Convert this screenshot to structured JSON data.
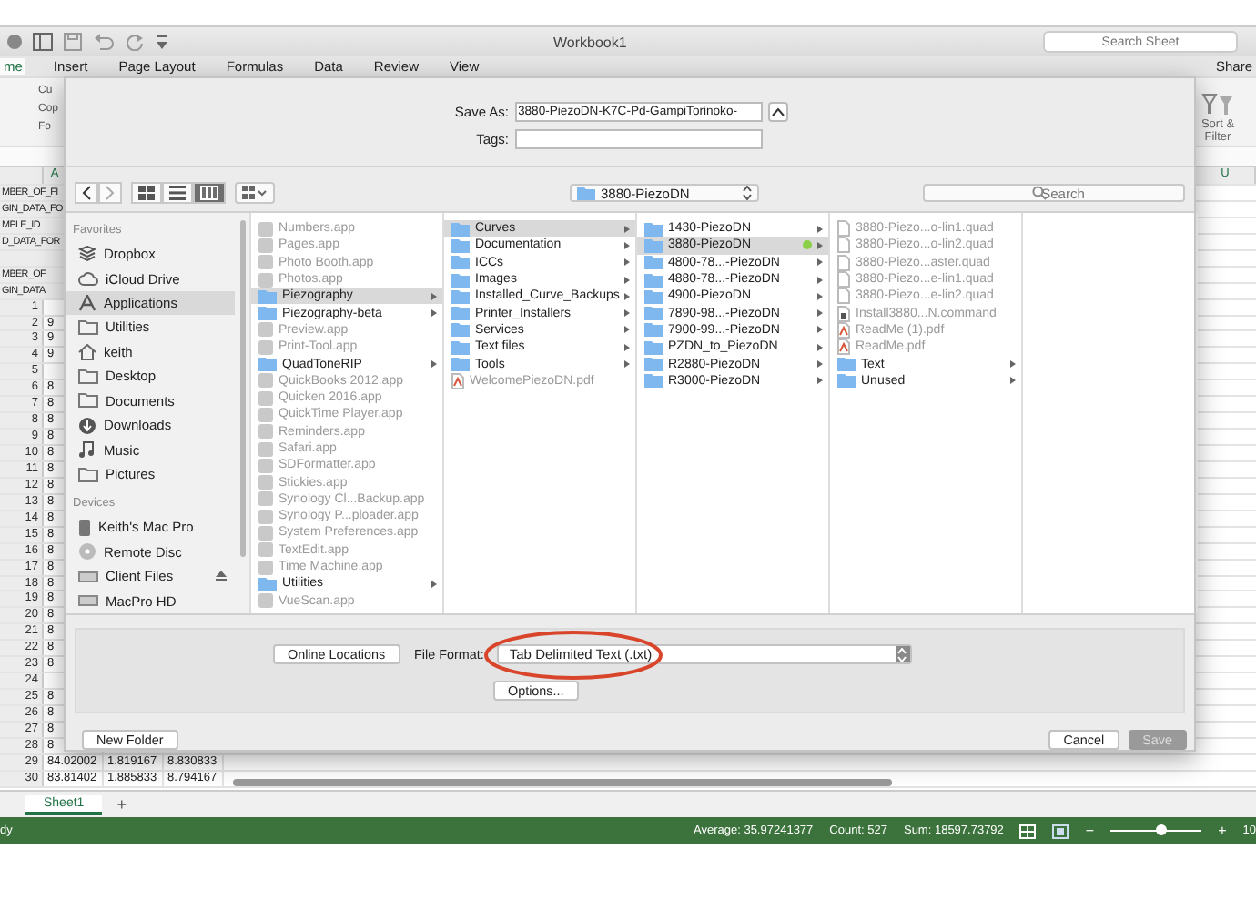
{
  "window": {
    "title": "Workbook1",
    "search_placeholder": "Search Sheet"
  },
  "ribbon_tabs": [
    {
      "label": "me",
      "selected": true
    },
    {
      "label": "Insert",
      "selected": false
    },
    {
      "label": "Page Layout",
      "selected": false
    },
    {
      "label": "Formulas",
      "selected": false
    },
    {
      "label": "Data",
      "selected": false
    },
    {
      "label": "Review",
      "selected": false
    },
    {
      "label": "View",
      "selected": false
    }
  ],
  "share": "Share",
  "ribbon": {
    "clipboard": [
      "Cu",
      "Cop",
      "Fo"
    ],
    "sort_filter": "Sort & Filter"
  },
  "grid": {
    "column_headers": [
      "A",
      "U"
    ],
    "label_rows": [
      "MBER_OF_FI",
      "GIN_DATA_FO",
      "MPLE_ID",
      "D_DATA_FOR",
      "",
      "MBER_OF",
      "GIN_DATA"
    ],
    "rows": [
      {
        "number": "1",
        "cells": []
      },
      {
        "number": "2",
        "cells": [
          "9"
        ]
      },
      {
        "number": "3",
        "cells": [
          "9"
        ]
      },
      {
        "number": "4",
        "cells": [
          "9"
        ]
      },
      {
        "number": "5",
        "cells": []
      },
      {
        "number": "6",
        "cells": [
          "8"
        ]
      },
      {
        "number": "7",
        "cells": [
          "8"
        ]
      },
      {
        "number": "8",
        "cells": [
          "8"
        ]
      },
      {
        "number": "9",
        "cells": [
          "8"
        ]
      },
      {
        "number": "10",
        "cells": [
          "8"
        ]
      },
      {
        "number": "11",
        "cells": [
          "8"
        ]
      },
      {
        "number": "12",
        "cells": [
          "8"
        ]
      },
      {
        "number": "13",
        "cells": [
          "8"
        ]
      },
      {
        "number": "14",
        "cells": [
          "8"
        ]
      },
      {
        "number": "15",
        "cells": [
          "8"
        ]
      },
      {
        "number": "16",
        "cells": [
          "8"
        ]
      },
      {
        "number": "17",
        "cells": [
          "8"
        ]
      },
      {
        "number": "18",
        "cells": [
          "8"
        ]
      },
      {
        "number": "19",
        "cells": [
          "8"
        ]
      },
      {
        "number": "20",
        "cells": [
          "8"
        ]
      },
      {
        "number": "21",
        "cells": [
          "8"
        ]
      },
      {
        "number": "22",
        "cells": [
          "8"
        ]
      },
      {
        "number": "23",
        "cells": [
          "8"
        ]
      },
      {
        "number": "24",
        "cells": []
      },
      {
        "number": "25",
        "cells": [
          "8"
        ]
      },
      {
        "number": "26",
        "cells": [
          "8"
        ]
      },
      {
        "number": "27",
        "cells": [
          "8"
        ]
      },
      {
        "number": "28",
        "cells": [
          "8"
        ]
      },
      {
        "number": "29",
        "cells": [
          "84.02002",
          "1.819167",
          "8.830833"
        ]
      },
      {
        "number": "30",
        "cells": [
          "83.81402",
          "1.885833",
          "8.794167"
        ]
      }
    ]
  },
  "sheet_tabs": [
    {
      "label": "Sheet1",
      "selected": true
    }
  ],
  "add_sheet": "+",
  "status_bar": {
    "mode": "dy",
    "average": "Average: 35.97241377",
    "count": "Count: 527",
    "sum": "Sum: 18597.73792",
    "zoom_out": "−",
    "zoom_in": "+",
    "zoom_value": "10",
    "zoom": {
      "level": 0.55
    }
  },
  "dialog": {
    "save_as_label": "Save As:",
    "save_as_value": "3880-PiezoDN-K7C-Pd-GampiTorinoko-",
    "tags_label": "Tags:",
    "view_modes": [
      {
        "kind": "icons",
        "selected": false
      },
      {
        "kind": "list",
        "selected": false
      },
      {
        "kind": "columns",
        "selected": true
      }
    ],
    "location": "3880-PiezoDN",
    "search_placeholder": "Search",
    "sidebar": [
      {
        "heading": "Favorites",
        "items": [
          {
            "label": "Dropbox",
            "kind": "box",
            "selected": false,
            "ejectable": false
          },
          {
            "label": "iCloud Drive",
            "kind": "cloud",
            "selected": false,
            "ejectable": false
          },
          {
            "label": "Applications",
            "kind": "apps",
            "selected": true,
            "ejectable": false
          },
          {
            "label": "Utilities",
            "kind": "folder",
            "selected": false,
            "ejectable": false
          },
          {
            "label": "keith",
            "kind": "home",
            "selected": false,
            "ejectable": false
          },
          {
            "label": "Desktop",
            "kind": "folder",
            "selected": false,
            "ejectable": false
          },
          {
            "label": "Documents",
            "kind": "folder",
            "selected": false,
            "ejectable": false
          },
          {
            "label": "Downloads",
            "kind": "download",
            "selected": false,
            "ejectable": false
          },
          {
            "label": "Music",
            "kind": "music",
            "selected": false,
            "ejectable": false
          },
          {
            "label": "Pictures",
            "kind": "folder",
            "selected": false,
            "ejectable": false
          }
        ]
      },
      {
        "heading": "Devices",
        "items": [
          {
            "label": "Keith's Mac Pro",
            "kind": "computer",
            "selected": false,
            "ejectable": false
          },
          {
            "label": "Remote Disc",
            "kind": "disc",
            "selected": false,
            "ejectable": false
          },
          {
            "label": "Client Files",
            "kind": "drive",
            "selected": false,
            "ejectable": true
          },
          {
            "label": "MacPro HD",
            "kind": "drive",
            "selected": false,
            "ejectable": false
          }
        ]
      }
    ],
    "columns": [
      [
        {
          "name": "Numbers.app",
          "kind": "app",
          "selected": false
        },
        {
          "name": "Pages.app",
          "kind": "app",
          "selected": false
        },
        {
          "name": "Photo Booth.app",
          "kind": "app",
          "selected": false
        },
        {
          "name": "Photos.app",
          "kind": "app",
          "selected": false
        },
        {
          "name": "Piezography",
          "kind": "folder",
          "selected": true
        },
        {
          "name": "Piezography-beta",
          "kind": "folder",
          "selected": false
        },
        {
          "name": "Preview.app",
          "kind": "app",
          "selected": false
        },
        {
          "name": "Print-Tool.app",
          "kind": "app",
          "selected": false
        },
        {
          "name": "QuadToneRIP",
          "kind": "folder",
          "selected": false
        },
        {
          "name": "QuickBooks 2012.app",
          "kind": "app",
          "selected": false
        },
        {
          "name": "Quicken 2016.app",
          "kind": "app",
          "selected": false
        },
        {
          "name": "QuickTime Player.app",
          "kind": "app",
          "selected": false
        },
        {
          "name": "Reminders.app",
          "kind": "app",
          "selected": false
        },
        {
          "name": "Safari.app",
          "kind": "app",
          "selected": false
        },
        {
          "name": "SDFormatter.app",
          "kind": "app",
          "selected": false
        },
        {
          "name": "Stickies.app",
          "kind": "app",
          "selected": false
        },
        {
          "name": "Synology Cl...Backup.app",
          "kind": "app",
          "selected": false
        },
        {
          "name": "Synology P...ploader.app",
          "kind": "app",
          "selected": false
        },
        {
          "name": "System Preferences.app",
          "kind": "app",
          "selected": false
        },
        {
          "name": "TextEdit.app",
          "kind": "app",
          "selected": false
        },
        {
          "name": "Time Machine.app",
          "kind": "app",
          "selected": false
        },
        {
          "name": "Utilities",
          "kind": "folder",
          "selected": false
        },
        {
          "name": "VueScan.app",
          "kind": "app",
          "selected": false
        }
      ],
      [
        {
          "name": "Curves",
          "kind": "folder",
          "selected": true
        },
        {
          "name": "Documentation",
          "kind": "folder",
          "selected": false
        },
        {
          "name": "ICCs",
          "kind": "folder",
          "selected": false
        },
        {
          "name": "Images",
          "kind": "folder",
          "selected": false
        },
        {
          "name": "Installed_Curve_Backups",
          "kind": "folder",
          "selected": false
        },
        {
          "name": "Printer_Installers",
          "kind": "folder",
          "selected": false
        },
        {
          "name": "Services",
          "kind": "folder",
          "selected": false
        },
        {
          "name": "Text files",
          "kind": "folder",
          "selected": false
        },
        {
          "name": "Tools",
          "kind": "folder",
          "selected": false
        },
        {
          "name": "WelcomePiezoDN.pdf",
          "kind": "pdf",
          "selected": false
        }
      ],
      [
        {
          "name": "1430-PiezoDN",
          "kind": "folder",
          "selected": false
        },
        {
          "name": "3880-PiezoDN",
          "kind": "folder",
          "selected": true,
          "color": "#8cd04a"
        },
        {
          "name": "4800-78...-PiezoDN",
          "kind": "folder",
          "selected": false
        },
        {
          "name": "4880-78...-PiezoDN",
          "kind": "folder",
          "selected": false
        },
        {
          "name": "4900-PiezoDN",
          "kind": "folder",
          "selected": false
        },
        {
          "name": "7890-98...-PiezoDN",
          "kind": "folder",
          "selected": false
        },
        {
          "name": "7900-99...-PiezoDN",
          "kind": "folder",
          "selected": false
        },
        {
          "name": "PZDN_to_PiezoDN",
          "kind": "folder",
          "selected": false
        },
        {
          "name": "R2880-PiezoDN",
          "kind": "folder",
          "selected": false
        },
        {
          "name": "R3000-PiezoDN",
          "kind": "folder",
          "selected": false
        }
      ],
      [
        {
          "name": "3880-Piezo...o-lin1.quad",
          "kind": "file",
          "selected": false
        },
        {
          "name": "3880-Piezo...o-lin2.quad",
          "kind": "file",
          "selected": false
        },
        {
          "name": "3880-Piezo...aster.quad",
          "kind": "file",
          "selected": false
        },
        {
          "name": "3880-Piezo...e-lin1.quad",
          "kind": "file",
          "selected": false
        },
        {
          "name": "3880-Piezo...e-lin2.quad",
          "kind": "file",
          "selected": false
        },
        {
          "name": "Install3880...N.command",
          "kind": "script",
          "selected": false
        },
        {
          "name": "ReadMe (1).pdf",
          "kind": "pdf",
          "selected": false
        },
        {
          "name": "ReadMe.pdf",
          "kind": "pdf",
          "selected": false
        },
        {
          "name": "Text",
          "kind": "folder",
          "selected": false
        },
        {
          "name": "Unused",
          "kind": "folder",
          "selected": false
        }
      ],
      []
    ],
    "online_locations": "Online Locations",
    "file_format_label": "File Format:",
    "file_format": "Tab Delimited Text (.txt)",
    "options": "Options...",
    "new_folder": "New Folder",
    "cancel": "Cancel",
    "save": "Save",
    "save_disabled": true
  }
}
